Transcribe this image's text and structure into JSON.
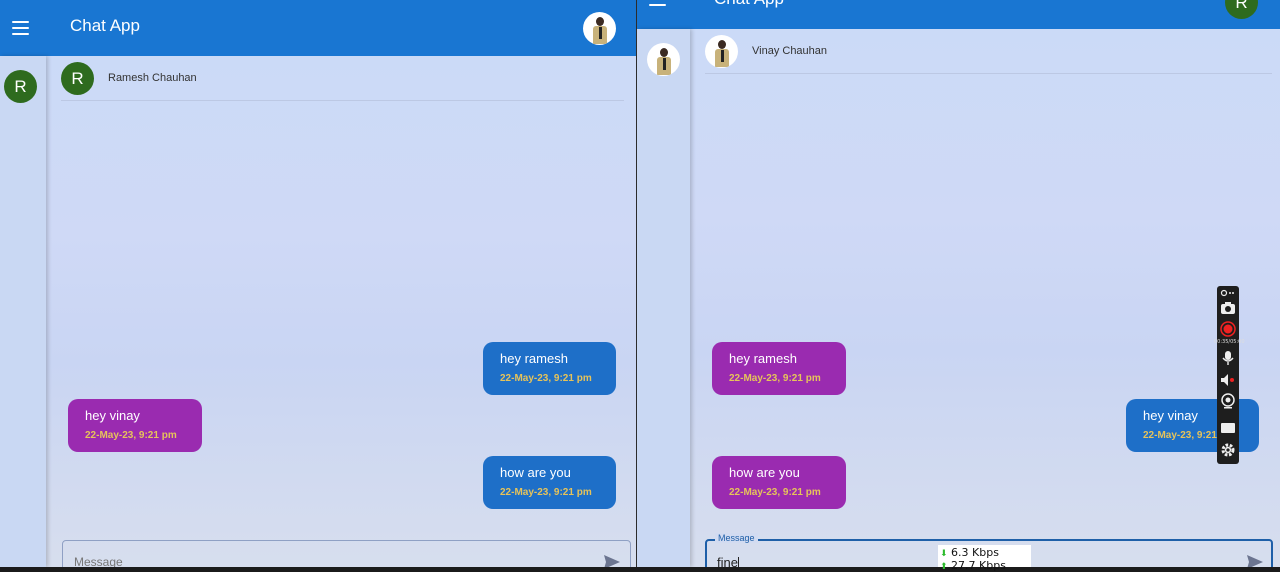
{
  "app": {
    "title": "Chat App"
  },
  "left_window": {
    "rail_avatar_letter": "R",
    "contact": {
      "avatar_letter": "R",
      "name": "Ramesh Chauhan"
    },
    "messages": [
      {
        "direction": "sent",
        "text": "hey ramesh",
        "time": "22-May-23, 9:21 pm"
      },
      {
        "direction": "received",
        "text": "hey vinay",
        "time": "22-May-23, 9:21 pm"
      },
      {
        "direction": "sent",
        "text": "how are you",
        "time": "22-May-23, 9:21 pm"
      }
    ],
    "input": {
      "placeholder": "Message",
      "value": ""
    }
  },
  "right_window": {
    "header_avatar_letter": "R",
    "contact": {
      "name": "Vinay Chauhan"
    },
    "messages": [
      {
        "direction": "received",
        "text": "hey ramesh",
        "time": "22-May-23, 9:21 pm"
      },
      {
        "direction": "sent",
        "text": "hey vinay",
        "time": "22-May-23, 9:21 pm"
      },
      {
        "direction": "received",
        "text": "how are you",
        "time": "22-May-23, 9:21 pm"
      }
    ],
    "input": {
      "label": "Message",
      "value": "fine"
    }
  },
  "recorder_toolbar": {
    "timer": "00:35/05:00",
    "icons": [
      "pin-icon",
      "camera-icon",
      "record-icon",
      "microphone-icon",
      "speaker-icon",
      "webcam-icon",
      "screen-icon",
      "settings-icon"
    ]
  },
  "network_monitor": {
    "download": "6.3 Kbps",
    "upload": "27.7 Kbps"
  },
  "colors": {
    "appbar": "#1976d2",
    "sent_bubble": "#1e6fc8",
    "received_bubble": "#9a2bb0",
    "timestamp": "#e6c35a",
    "avatar_green": "#2e6b1e"
  }
}
